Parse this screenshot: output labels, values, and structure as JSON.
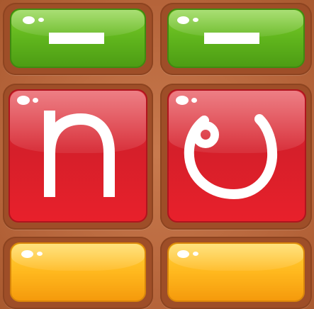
{
  "board": {
    "tiles": [
      {
        "row": "top",
        "col": "left",
        "color": "green",
        "symbol": "minus"
      },
      {
        "row": "top",
        "col": "right",
        "color": "green",
        "symbol": "minus"
      },
      {
        "row": "middle",
        "col": "left",
        "color": "red",
        "glyph": "n"
      },
      {
        "row": "middle",
        "col": "right",
        "color": "red",
        "glyph": "ల"
      },
      {
        "row": "bottom",
        "col": "left",
        "color": "orange",
        "symbol": "none"
      },
      {
        "row": "bottom",
        "col": "right",
        "color": "orange",
        "symbol": "none"
      }
    ]
  },
  "colors": {
    "green": "#5eb31c",
    "red": "#d51f2a",
    "orange": "#ffb81e",
    "wood": "#b8663c"
  }
}
